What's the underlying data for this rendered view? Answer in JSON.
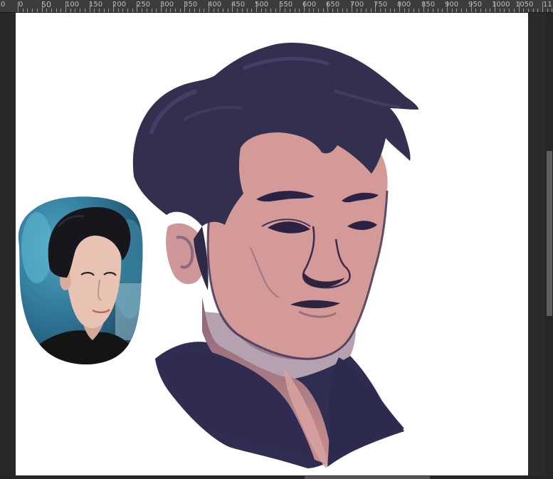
{
  "ruler": {
    "labels": [
      "0",
      "0",
      "50",
      "100",
      "150",
      "200",
      "250",
      "300",
      "350",
      "400",
      "450",
      "500",
      "550",
      "600",
      "650",
      "700",
      "750",
      "800",
      "850",
      "900",
      "950",
      "1000",
      "1050",
      "11"
    ]
  },
  "canvas": {
    "background": "#ffffff",
    "content": "digital painting of a man's head with dark navy hair and a reference photo"
  },
  "colors": {
    "hair": "#33304f",
    "skin": "#d39a98",
    "shirt": "#302d52",
    "outline": "#2d2446",
    "ui_bg": "#282828",
    "ruler_bg": "#3c3c3c"
  }
}
